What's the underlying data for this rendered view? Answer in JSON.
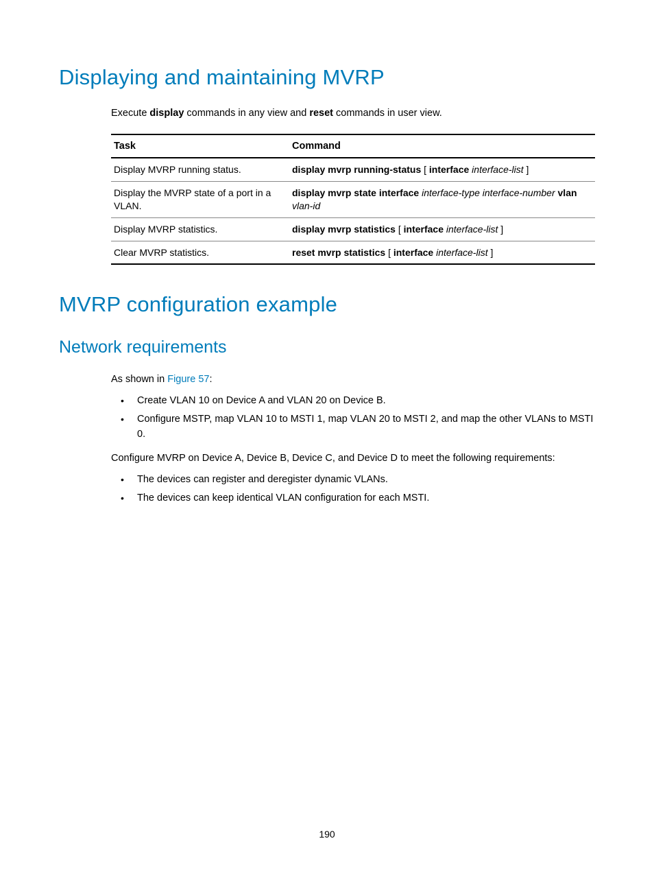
{
  "h1a": "Displaying and maintaining MVRP",
  "intro_pre": "Execute ",
  "intro_b1": "display",
  "intro_mid": " commands in any view and ",
  "intro_b2": "reset",
  "intro_post": " commands in user view.",
  "th_task": "Task",
  "th_cmd": "Command",
  "rows": [
    {
      "task": "Display MVRP running status.",
      "cmd_b1": "display mvrp running-status",
      "cmd_t1": " [ ",
      "cmd_b2": "interface",
      "cmd_t2": " ",
      "cmd_i1": "interface-list",
      "cmd_t3": " ]"
    },
    {
      "task": "Display the MVRP state of a port in a VLAN.",
      "cmd_b1": "display mvrp state interface",
      "cmd_t1": " ",
      "cmd_i1": "interface-type interface-number",
      "cmd_t2": " ",
      "cmd_b2": "vlan",
      "cmd_t3": " ",
      "cmd_i2": "vlan-id"
    },
    {
      "task": "Display MVRP statistics.",
      "cmd_b1": "display mvrp statistics",
      "cmd_t1": " [ ",
      "cmd_b2": "interface",
      "cmd_t2": " ",
      "cmd_i1": "interface-list",
      "cmd_t3": " ]"
    },
    {
      "task": "Clear MVRP statistics.",
      "cmd_b1": "reset mvrp statistics",
      "cmd_t1": " [ ",
      "cmd_b2": "interface",
      "cmd_t2": " ",
      "cmd_i1": "interface-list",
      "cmd_t3": " ]"
    }
  ],
  "h1b": "MVRP configuration example",
  "h2a": "Network requirements",
  "p1_pre": "As shown in ",
  "p1_link": "Figure 57",
  "p1_post": ":",
  "list1": [
    "Create VLAN 10 on Device A and VLAN 20 on Device B.",
    "Configure MSTP, map VLAN 10 to MSTI 1, map VLAN 20 to MSTI 2, and map the other VLANs to MSTI 0."
  ],
  "p2": "Configure MVRP on Device A, Device B, Device C, and Device D to meet the following requirements:",
  "list2": [
    "The devices can register and deregister dynamic VLANs.",
    "The devices can keep identical VLAN configuration for each MSTI."
  ],
  "page": "190"
}
